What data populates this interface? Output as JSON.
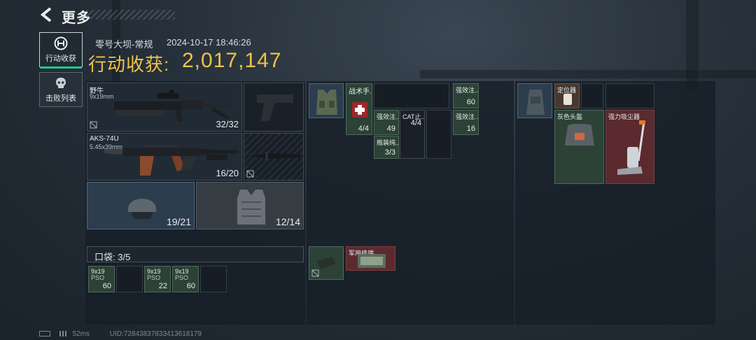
{
  "header": {
    "title": "更多"
  },
  "tabs": [
    {
      "label": "行动收获",
      "active": true,
      "icon": "haul-icon"
    },
    {
      "label": "击败列表",
      "active": false,
      "icon": "skull-icon"
    }
  ],
  "info": {
    "map_mode": "零号大坝-常规",
    "timestamp": "2024-10-17 18:46:26",
    "haul_label": "行动收获:",
    "haul_value": "2,017,147"
  },
  "weapons": [
    {
      "name": "野牛",
      "caliber": "9x19mm",
      "ammo": "32/32"
    },
    {
      "name": "AKS-74U",
      "caliber": "5.45x39mm",
      "ammo": "16/20"
    }
  ],
  "gear": {
    "helmet_durability": "19/21",
    "armor_durability": "12/14"
  },
  "pocket": {
    "label": "口袋: 3/5",
    "items": [
      {
        "name": "9x19",
        "sub": "PSO",
        "count": "60"
      },
      {
        "name": "9x19",
        "sub": "PSO",
        "count": "22"
      },
      {
        "name": "9x19",
        "sub": "PSO",
        "count": "60"
      }
    ]
  },
  "rig": {
    "items": {
      "tactical": {
        "name": "战术手...",
        "count": "4/4"
      },
      "stim1": {
        "name": "强效注...",
        "count": "60"
      },
      "stim2": {
        "name": "强效注...",
        "count": "49"
      },
      "cat": {
        "name": "CAT止...",
        "count": "4/4"
      },
      "stim3": {
        "name": "强效注...",
        "count": "16"
      },
      "bottle": {
        "name": "瓶装纯...",
        "count": "3/3"
      }
    }
  },
  "pouch": {
    "item_name": "军用终端"
  },
  "backpack": {
    "locator": "定位器",
    "gray_box": "灰色头盔",
    "vacuum": "强力吸尘器"
  },
  "status": {
    "ping": "52ms",
    "uid": "UID:7284383783341361817​9"
  },
  "colors": {
    "accent_gold": "#efc24c",
    "active_green": "#22c98c",
    "rare_red": "#5a2a2e",
    "uncommon_green": "#2c4236"
  }
}
